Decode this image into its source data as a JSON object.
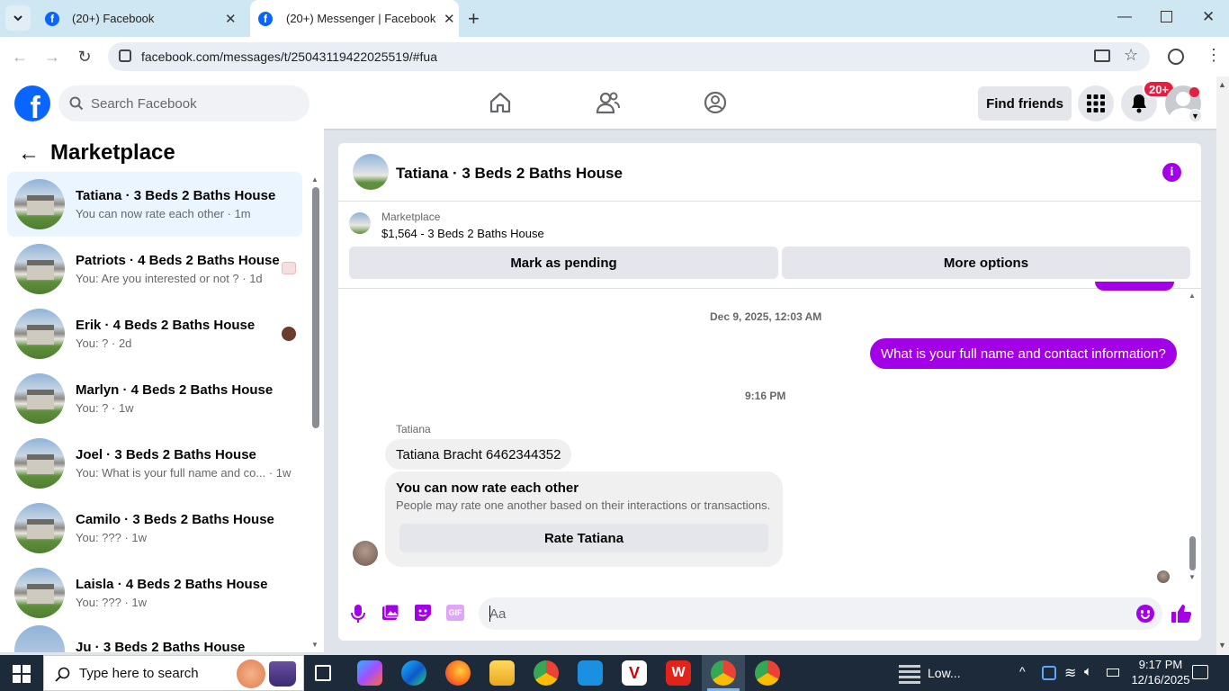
{
  "browser": {
    "tabs": [
      {
        "label": "(20+) Facebook",
        "active": false
      },
      {
        "label": "(20+) Messenger | Facebook",
        "active": true
      }
    ],
    "url": "facebook.com/messages/t/25043119422025519/#fua",
    "new_tab": "+"
  },
  "fb": {
    "search_placeholder": "Search Facebook",
    "find_friends": "Find friends",
    "notification_badge": "20+",
    "brand_color": "#0866ff"
  },
  "sidebar": {
    "title": "Marketplace",
    "conversations": [
      {
        "title": "Tatiana · 3 Beds 2 Baths House",
        "sub": "You can now rate each other · 1m",
        "selected": true
      },
      {
        "title": "Patriots · 4 Beds 2 Baths House",
        "sub": "You: Are you interested or not ? · 1d"
      },
      {
        "title": "Erik · 4 Beds 2 Baths House",
        "sub": "You: ? · 2d"
      },
      {
        "title": "Marlyn · 4 Beds 2 Baths House",
        "sub": "You: ? · 1w"
      },
      {
        "title": "Joel · 3 Beds 2 Baths House",
        "sub": "You: What is your full name and co... · 1w"
      },
      {
        "title": "Camilo · 3 Beds 2 Baths House",
        "sub": "You: ??? · 1w"
      },
      {
        "title": "Laisla · 4 Beds 2 Baths House",
        "sub": "You: ??? · 1w"
      },
      {
        "title": "Ju · 3 Beds 2 Baths House",
        "sub": ""
      }
    ]
  },
  "chat": {
    "header_title": "Tatiana · 3 Beds 2 Baths House",
    "listing_label": "Marketplace",
    "listing_price": "$1,564 - 3 Beds 2 Baths House",
    "mark_pending": "Mark as pending",
    "more_options": "More options",
    "timestamp1": "Dec 9, 2025, 12:03 AM",
    "outgoing_msg": "What is your full name and contact information?",
    "timestamp2": "9:16 PM",
    "sender_name": "Tatiana",
    "incoming_msg": "Tatiana Bracht 6462344352",
    "rate_title": "You can now rate each other",
    "rate_desc": "People may rate one another based on their interactions or transactions.",
    "rate_button": "Rate Tatiana",
    "composer_placeholder": "Aa",
    "accent_color": "#a400e8"
  },
  "taskbar": {
    "search_placeholder": "Type here to search",
    "weather": "Low...",
    "time": "9:17 PM",
    "date": "12/16/2025"
  }
}
